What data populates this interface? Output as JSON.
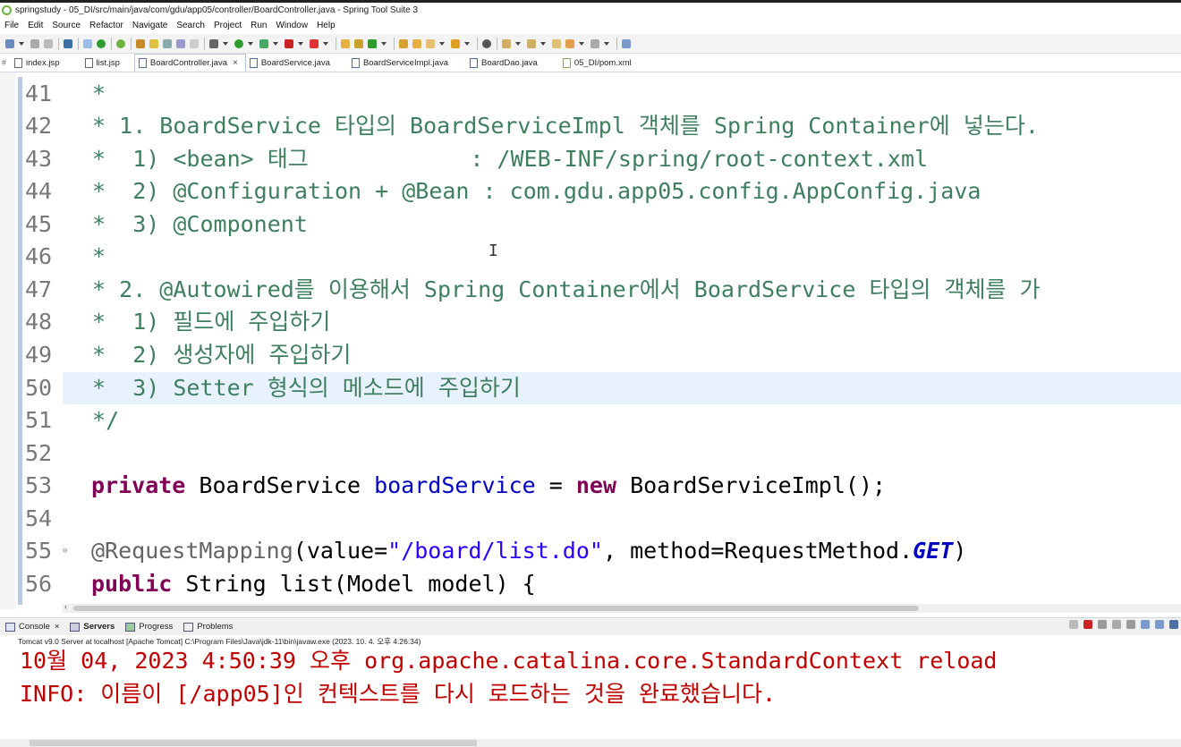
{
  "window": {
    "title": "springstudy - 05_DI/src/main/java/com/gdu/app05/controller/BoardController.java - Spring Tool Suite 3"
  },
  "menu": [
    "File",
    "Edit",
    "Source",
    "Refactor",
    "Navigate",
    "Search",
    "Project",
    "Run",
    "Window",
    "Help"
  ],
  "editor_tabs": [
    {
      "label": "index.jsp",
      "active": false
    },
    {
      "label": "list.jsp",
      "active": false
    },
    {
      "label": "BoardController.java",
      "active": true
    },
    {
      "label": "BoardService.java",
      "active": false
    },
    {
      "label": "BoardServiceImpl.java",
      "active": false
    },
    {
      "label": "BoardDao.java",
      "active": false
    },
    {
      "label": "05_DI/pom.xml",
      "active": false
    }
  ],
  "code_lines": [
    {
      "num": "41",
      "text": " *"
    },
    {
      "num": "42",
      "text": " * 1. BoardService 타입의 BoardServiceImpl 객체를 Spring Container에 넣는다."
    },
    {
      "num": "43",
      "text": " *  1) <bean> 태그            : /WEB-INF/spring/root-context.xml"
    },
    {
      "num": "44",
      "text": " *  2) @Configuration + @Bean : com.gdu.app05.config.AppConfig.java"
    },
    {
      "num": "45",
      "text": " *  3) @Component"
    },
    {
      "num": "46",
      "text": " *"
    },
    {
      "num": "47",
      "text": " * 2. @Autowired를 이용해서 Spring Container에서 BoardService 타입의 객체를 가"
    },
    {
      "num": "48",
      "text": " *  1) 필드에 주입하기"
    },
    {
      "num": "49",
      "text": " *  2) 생성자에 주입하기"
    },
    {
      "num": "50",
      "text": " *  3) Setter 형식의 메소드에 주입하기"
    },
    {
      "num": "51",
      "text": " */"
    },
    {
      "num": "52",
      "text": ""
    },
    {
      "num": "53",
      "parts": [
        "private",
        " BoardService ",
        "boardService",
        " = ",
        "new",
        " BoardServiceImpl();"
      ]
    },
    {
      "num": "54",
      "text": ""
    },
    {
      "num": "55",
      "parts": [
        "@RequestMapping",
        "(value=",
        "\"/board/list.do\"",
        ", method=RequestMethod.",
        "GET",
        ")"
      ]
    },
    {
      "num": "56",
      "parts": [
        "public",
        " String list(Model ",
        "model",
        ") {"
      ]
    }
  ],
  "console_tabs": [
    {
      "label": "Console",
      "bold": false,
      "closable": true
    },
    {
      "label": "Servers",
      "bold": true,
      "closable": false
    },
    {
      "label": "Progress",
      "bold": false,
      "closable": false
    },
    {
      "label": "Problems",
      "bold": false,
      "closable": false
    }
  ],
  "server_line": "Tomcat v9.0 Server at localhost [Apache Tomcat] C:\\Program Files\\Java\\jdk-11\\bin\\javaw.exe  (2023. 10. 4. 오후 4:26:34)",
  "console_lines": [
    "10월 04, 2023 4:50:39 오후 org.apache.catalina.core.StandardContext reload",
    "INFO: 이름이 [/app05]인 컨텍스트를 다시 로드하는 것을 완료했습니다."
  ],
  "colors": {
    "comment": "#3f7f5f",
    "keyword": "#7f0055",
    "field": "#0000c0",
    "string": "#2a00ff",
    "console_text": "#c00000",
    "highlight_line": "#e8f2fe"
  }
}
